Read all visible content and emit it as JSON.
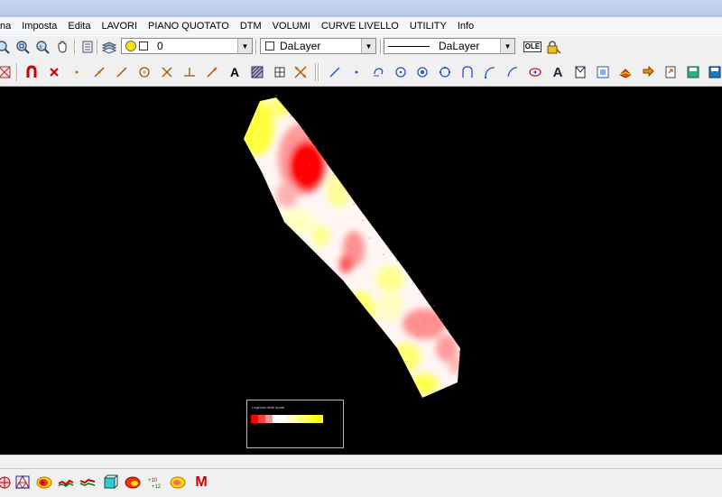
{
  "menu": [
    "na",
    "Imposta",
    "Edita",
    "LAVORI",
    "PIANO QUOTATO",
    "DTM",
    "VOLUMI",
    "CURVE LIVELLO",
    "UTILITY",
    "Info"
  ],
  "toolbar1": {
    "layer_value": "0",
    "color_value": "DaLayer",
    "linetype_value": "DaLayer",
    "ole_label": "OLE"
  },
  "drawing": {
    "legend_title": "Legenda delle quote",
    "legend_colors": [
      "#ff0000",
      "#ff4040",
      "#ff9090",
      "#ffffff",
      "#ffffff",
      "#fffccc",
      "#ffff99",
      "#ffff66",
      "#ffff33",
      "#ffff00"
    ],
    "legend_tick_labels": [
      "",
      "",
      "",
      "",
      "",
      "",
      "",
      "",
      "",
      ""
    ]
  },
  "bottom_toolbar": {
    "m_label": "M"
  },
  "icons": {
    "toolbar1": [
      "zoom-extents-icon",
      "zoom-window-icon",
      "zoom-realtime-icon",
      "pan-icon",
      "properties-icon",
      "layers-icon"
    ],
    "toolbar2_left": [
      "magnet-icon",
      "erase-icon",
      "point-icon",
      "line-icon",
      "polyline-icon",
      "circle-icon",
      "cross-icon",
      "perpendicular-icon",
      "snap-line-icon",
      "text-a-icon",
      "hatch-icon",
      "explode-icon"
    ],
    "toolbar2_right": [
      "draw-line-icon",
      "draw-point-icon",
      "arc-rotate-icon",
      "circle-center-icon",
      "circle-radius-icon",
      "circle-3p-icon",
      "arc-icon",
      "arc-2-icon",
      "arc-3-icon",
      "ellipse-icon",
      "text-icon",
      "insert-block-icon",
      "move-icon",
      "rotate-icon",
      "surface-icon",
      "export-icon",
      "save-icon",
      "save-as-icon",
      "print-icon"
    ],
    "bottom": [
      "network-icon",
      "tin-icon",
      "contour-map-icon",
      "profile-icon",
      "section-icon",
      "cube-icon",
      "color-map-icon",
      "spot-heights-icon",
      "legend-map-icon"
    ]
  }
}
